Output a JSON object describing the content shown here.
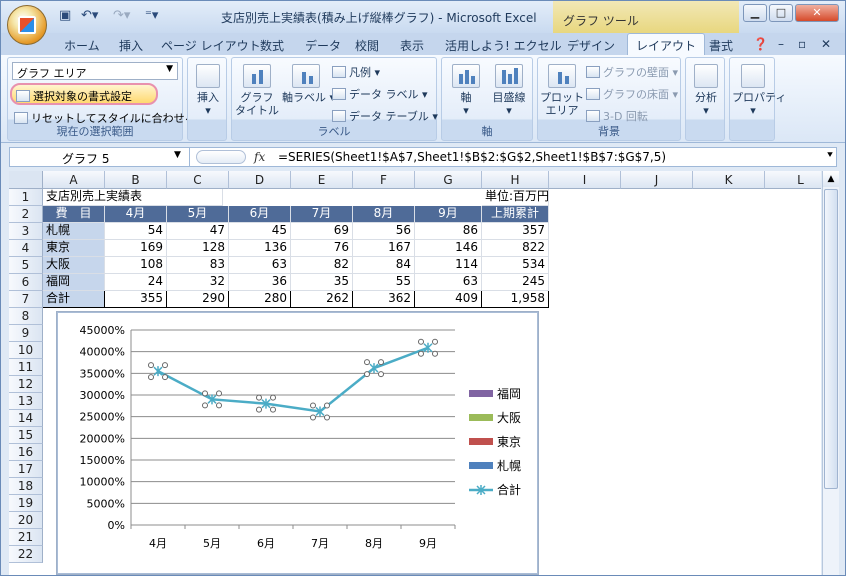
{
  "titlebar": {
    "title": "支店別売上実績表(積み上げ縦棒グラフ) - Microsoft Excel",
    "tool_tab": "グラフ ツール",
    "save_icon": "save-icon",
    "undo_icon": "undo-icon",
    "redo_icon": "redo-icon"
  },
  "tabs": [
    "ホーム",
    "挿入",
    "ページ レイアウト",
    "数式",
    "データ",
    "校閲",
    "表示",
    "活用しよう! エクセル",
    "デザイン",
    "レイアウト",
    "書式"
  ],
  "ribbon": {
    "current_selection": {
      "dropdown_value": "グラフ エリア",
      "format_selection": "選択対象の書式設定",
      "reset_style": "リセットしてスタイルに合わせる",
      "label": "現在の選択範囲"
    },
    "insert": {
      "label": "挿入"
    },
    "labels_group": {
      "chart_title": "グラフ\nタイトル",
      "axis_titles": "軸ラベル",
      "legend": "凡例",
      "data_labels": "データ ラベル",
      "data_table": "データ テーブル",
      "label": "ラベル"
    },
    "axes_group": {
      "axes": "軸",
      "gridlines": "目盛線",
      "label": "軸"
    },
    "background_group": {
      "plot_area": "プロット\nエリア",
      "chart_wall": "グラフの壁面",
      "chart_floor": "グラフの床面",
      "rotation": "3-D 回転",
      "label": "背景"
    },
    "analysis": "分析",
    "properties": "プロパティ"
  },
  "formula_bar": {
    "name_box": "グラフ 5",
    "fx": "fx",
    "formula": "=SERIES(Sheet1!$A$7,Sheet1!$B$2:$G$2,Sheet1!$B$7:$G$7,5)"
  },
  "columns": [
    "A",
    "B",
    "C",
    "D",
    "E",
    "F",
    "G",
    "H",
    "I",
    "J",
    "K",
    "L"
  ],
  "rows": [
    "1",
    "2",
    "3",
    "4",
    "5",
    "6",
    "7",
    "8",
    "9",
    "10",
    "11",
    "12",
    "13",
    "14",
    "15",
    "16",
    "17",
    "18",
    "19",
    "20",
    "21",
    "22"
  ],
  "table": {
    "title": "支店別売上実績表",
    "unit": "単位:百万円",
    "header_item": "費　目",
    "months": [
      "4月",
      "5月",
      "6月",
      "7月",
      "8月",
      "9月"
    ],
    "total_header": "上期累計",
    "data": [
      {
        "name": "札幌",
        "values": [
          "54",
          "47",
          "45",
          "69",
          "56",
          "86"
        ],
        "total": "357"
      },
      {
        "name": "東京",
        "values": [
          "169",
          "128",
          "136",
          "76",
          "167",
          "146"
        ],
        "total": "822"
      },
      {
        "name": "大阪",
        "values": [
          "108",
          "83",
          "63",
          "82",
          "84",
          "114"
        ],
        "total": "534"
      },
      {
        "name": "福岡",
        "values": [
          "24",
          "32",
          "36",
          "35",
          "55",
          "63"
        ],
        "total": "245"
      },
      {
        "name": "合計",
        "values": [
          "355",
          "290",
          "280",
          "262",
          "362",
          "409"
        ],
        "total": "1,958"
      }
    ]
  },
  "chart_data": {
    "type": "line",
    "categories": [
      "4月",
      "5月",
      "6月",
      "7月",
      "8月",
      "9月"
    ],
    "yticks": [
      "0%",
      "5000%",
      "10000%",
      "15000%",
      "20000%",
      "25000%",
      "30000%",
      "35000%",
      "40000%",
      "45000%"
    ],
    "ylim": [
      0,
      45000
    ],
    "series": [
      {
        "name": "合計",
        "values": [
          35500,
          29000,
          28000,
          26200,
          36200,
          40900
        ],
        "color": "#4bacc6"
      }
    ],
    "legend": [
      {
        "name": "福岡",
        "color": "#8064a2",
        "kind": "bar"
      },
      {
        "name": "大阪",
        "color": "#9bbb59",
        "kind": "bar"
      },
      {
        "name": "東京",
        "color": "#c0504d",
        "kind": "bar"
      },
      {
        "name": "札幌",
        "color": "#4f81bd",
        "kind": "bar"
      },
      {
        "name": "合計",
        "color": "#4bacc6",
        "kind": "line"
      }
    ],
    "legend_position": "right",
    "gridlines": true
  }
}
